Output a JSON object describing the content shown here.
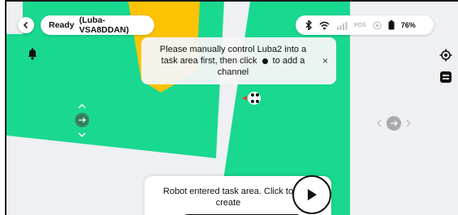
{
  "status": {
    "state": "Ready",
    "device": "(Luba-VSA8DDAN)"
  },
  "header_right": {
    "pos_label": "POS",
    "battery": "76%"
  },
  "toast": {
    "text_before": "Please manually control Luba2 into a task area first, then click",
    "text_after": "to add a channel",
    "close": "×"
  },
  "bottom": {
    "message": "Robot entered task area. Click to create"
  },
  "icons": {
    "back": "chevron-left-icon",
    "bluetooth": "bluetooth-icon",
    "wifi": "wifi-icon",
    "cellular": "cellular-4g-icon",
    "pos": "pos-signal-icon",
    "battery": "battery-icon",
    "bell": "bell-icon",
    "locate": "locate-icon",
    "layers": "layers-icon",
    "play": "play-icon"
  },
  "colors": {
    "zone_green": "#19d890",
    "zone_orange": "#fbc304",
    "map_bg": "#eef0f3"
  }
}
